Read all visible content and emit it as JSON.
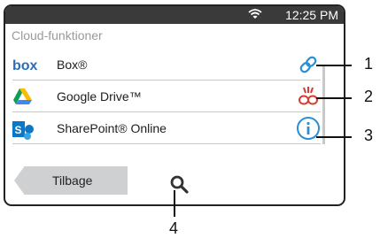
{
  "status_bar": {
    "time": "12:25 PM",
    "wifi_icon": "wifi-icon"
  },
  "section_title": "Cloud-funktioner",
  "services": [
    {
      "label": "Box®",
      "logo_text": "box",
      "status_icon": "link-icon",
      "logo_color": "#2a6db5",
      "status_color": "#2b8fd6"
    },
    {
      "label": "Google Drive™",
      "status_icon": "broken-link-icon",
      "status_color": "#d73b2e"
    },
    {
      "label": "SharePoint® Online",
      "logo_text": "S",
      "status_icon": "info-icon",
      "logo_color": "#0a78c7",
      "status_color": "#2b8fd6"
    }
  ],
  "footer": {
    "back_label": "Tilbage",
    "search_icon": "search-icon"
  },
  "callouts": [
    "1",
    "2",
    "3",
    "4"
  ]
}
